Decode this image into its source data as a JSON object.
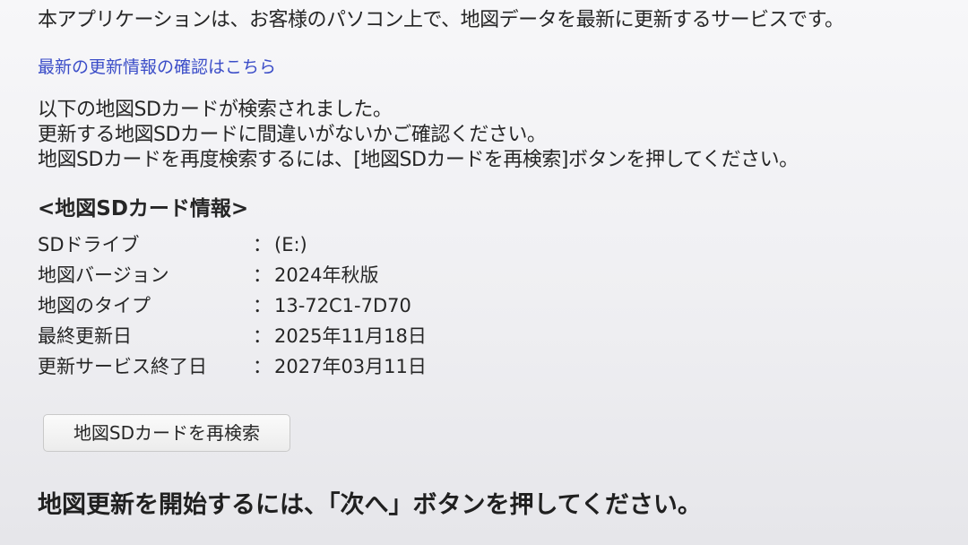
{
  "intro_text": "本アプリケーションは、お客様のパソコン上で、地図データを最新に更新するサービスです。",
  "update_info_link": "最新の更新情報の確認はこちら",
  "detection_message": [
    "以下の地図SDカードが検索されました。",
    "更新する地図SDカードに間違いがないかご確認ください。",
    "地図SDカードを再度検索するには、[地図SDカードを再検索]ボタンを押してください。"
  ],
  "card_info": {
    "title": "<地図SDカード情報>",
    "separator": "：",
    "rows": [
      {
        "label": "SDドライブ",
        "value": "(E:)"
      },
      {
        "label": "地図バージョン",
        "value": "2024年秋版"
      },
      {
        "label": "地図のタイプ",
        "value": "13-72C1-7D70"
      },
      {
        "label": "最終更新日",
        "value": "2025年11月18日"
      },
      {
        "label": "更新サービス終了日",
        "value": "2027年03月11日"
      }
    ]
  },
  "rescan_button_label": "地図SDカードを再検索",
  "start_instruction": "地図更新を開始するには、「次へ」ボタンを押してください。",
  "colors": {
    "link": "#3b4dc8",
    "text": "#262626",
    "background": "#f2f2f4"
  }
}
